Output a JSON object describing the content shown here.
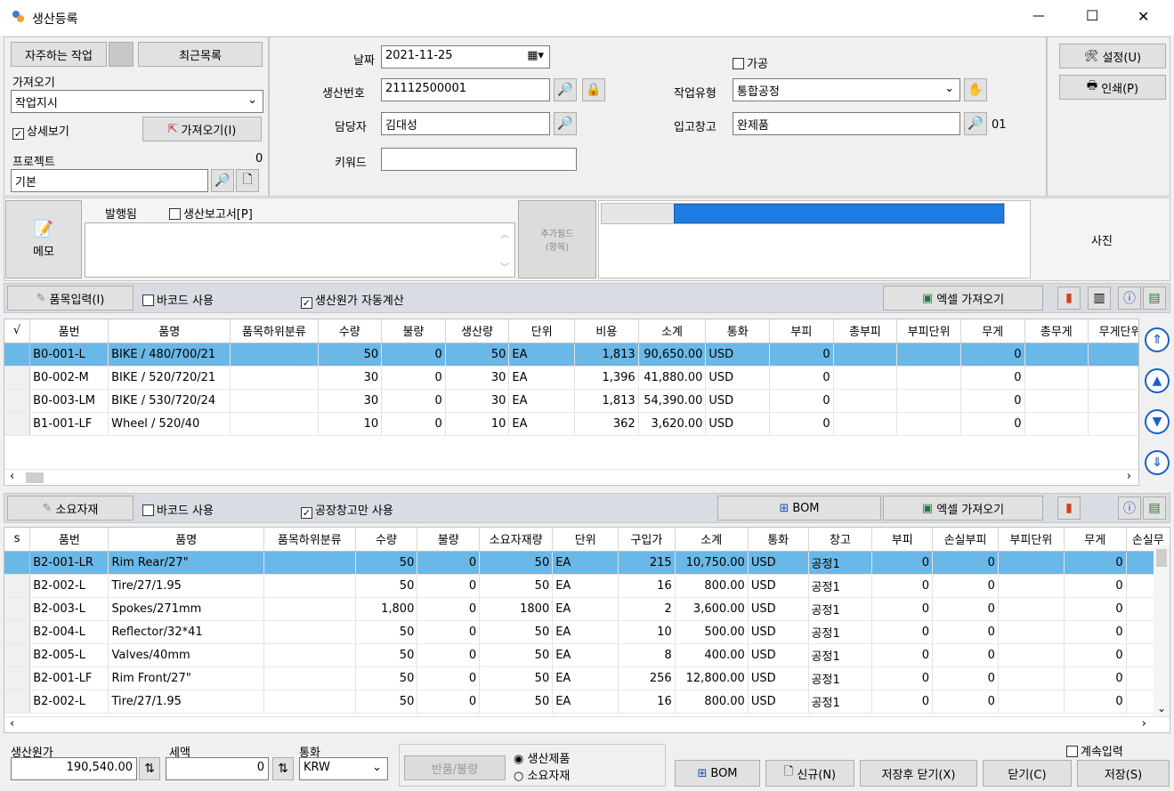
{
  "window": {
    "title": "생산등록",
    "minimize": "—",
    "maximize": "☐",
    "close": "✕"
  },
  "left_panel": {
    "frequent_btn": "자주하는 작업",
    "recent_btn": "최근목록",
    "import_label": "가져오기",
    "import_select": "작업지시",
    "detail_view": "상세보기",
    "import_btn": "가져오기(I)",
    "project_label": "프로젝트",
    "project_count": "0",
    "project_value": "기본"
  },
  "form": {
    "date_label": "날짜",
    "date_value": "2021-11-25",
    "prodno_label": "생산번호",
    "prodno_value": "21112500001",
    "manager_label": "담당자",
    "manager_value": "김대성",
    "keyword_label": "키워드",
    "keyword_value": "",
    "process_checkbox": "가공",
    "worktype_label": "작업유형",
    "worktype_value": "통합공정",
    "warehouse_label": "입고창고",
    "warehouse_value": "완제품",
    "warehouse_code": "01"
  },
  "right_buttons": {
    "settings": "설정(U)",
    "print": "인쇄(P)"
  },
  "memo": {
    "label": "메모",
    "issued": "발행됨",
    "report": "생산보고서[P]",
    "extra_field": "추가필드\n(항목)",
    "photo": "사진",
    "progress_pct": 82
  },
  "items_bar": {
    "input_btn": "품목입력(I)",
    "barcode": "바코드 사용",
    "auto_cost": "생산원가 자동계산",
    "excel_btn": "엑셀 가져오기"
  },
  "items_table": {
    "headers": [
      "√",
      "품번",
      "품명",
      "품목하위분류",
      "수량",
      "불량",
      "생산량",
      "단위",
      "비용",
      "소계",
      "통화",
      "부피",
      "총부피",
      "부피단위",
      "무게",
      "총무게",
      "무게단위"
    ],
    "rows": [
      [
        "",
        "B0-001-L",
        "BIKE / 480/700/21",
        "",
        "50",
        "0",
        "50",
        "EA",
        "1,813",
        "90,650.00",
        "USD",
        "0",
        "",
        "",
        "0",
        "",
        ""
      ],
      [
        "",
        "B0-002-M",
        "BIKE / 520/720/21",
        "",
        "30",
        "0",
        "30",
        "EA",
        "1,396",
        "41,880.00",
        "USD",
        "0",
        "",
        "",
        "0",
        "",
        ""
      ],
      [
        "",
        "B0-003-LM",
        "BIKE / 530/720/24",
        "",
        "30",
        "0",
        "30",
        "EA",
        "1,813",
        "54,390.00",
        "USD",
        "0",
        "",
        "",
        "0",
        "",
        ""
      ],
      [
        "",
        "B1-001-LF",
        "Wheel / 520/40",
        "",
        "10",
        "0",
        "10",
        "EA",
        "362",
        "3,620.00",
        "USD",
        "0",
        "",
        "",
        "0",
        "",
        ""
      ]
    ]
  },
  "materials_bar": {
    "btn": "소요자재",
    "barcode": "바코드 사용",
    "factory_only": "공장창고만 사용",
    "bom_btn": "BOM",
    "excel_btn": "엑셀 가져오기"
  },
  "materials_table": {
    "headers": [
      "s",
      "품번",
      "품명",
      "품목하위분류",
      "수량",
      "불량",
      "소요자재량",
      "단위",
      "구입가",
      "소계",
      "통화",
      "창고",
      "부피",
      "손실부피",
      "부피단위",
      "무게",
      "손실무"
    ],
    "rows": [
      [
        "",
        "B2-001-LR",
        "Rim Rear/27\"",
        "",
        "50",
        "0",
        "50",
        "EA",
        "215",
        "10,750.00",
        "USD",
        "공정1",
        "0",
        "0",
        "",
        "0",
        ""
      ],
      [
        "",
        "B2-002-L",
        "Tire/27/1.95",
        "",
        "50",
        "0",
        "50",
        "EA",
        "16",
        "800.00",
        "USD",
        "공정1",
        "0",
        "0",
        "",
        "0",
        ""
      ],
      [
        "",
        "B2-003-L",
        "Spokes/271mm",
        "",
        "1,800",
        "0",
        "1800",
        "EA",
        "2",
        "3,600.00",
        "USD",
        "공정1",
        "0",
        "0",
        "",
        "0",
        ""
      ],
      [
        "",
        "B2-004-L",
        "Reflector/32*41",
        "",
        "50",
        "0",
        "50",
        "EA",
        "10",
        "500.00",
        "USD",
        "공정1",
        "0",
        "0",
        "",
        "0",
        ""
      ],
      [
        "",
        "B2-005-L",
        "Valves/40mm",
        "",
        "50",
        "0",
        "50",
        "EA",
        "8",
        "400.00",
        "USD",
        "공정1",
        "0",
        "0",
        "",
        "0",
        ""
      ],
      [
        "",
        "B2-001-LF",
        "Rim Front/27\"",
        "",
        "50",
        "0",
        "50",
        "EA",
        "256",
        "12,800.00",
        "USD",
        "공정1",
        "0",
        "0",
        "",
        "0",
        ""
      ],
      [
        "",
        "B2-002-L",
        "Tire/27/1.95",
        "",
        "50",
        "0",
        "50",
        "EA",
        "16",
        "800.00",
        "USD",
        "공정1",
        "0",
        "0",
        "",
        "0",
        ""
      ]
    ]
  },
  "footer": {
    "cost_label": "생산원가",
    "cost_value": "190,540.00",
    "tax_label": "세액",
    "tax_value": "0",
    "currency_label": "통화",
    "currency_value": "KRW",
    "return_btn": "반품/불량",
    "radio_product": "생산제품",
    "radio_material": "소요자재",
    "continue_input": "계속입력",
    "bom_btn": "BOM",
    "new_btn": "신규(N)",
    "save_close_btn": "저장후 닫기(X)",
    "close_btn": "닫기(C)",
    "save_btn": "저장(S)"
  }
}
